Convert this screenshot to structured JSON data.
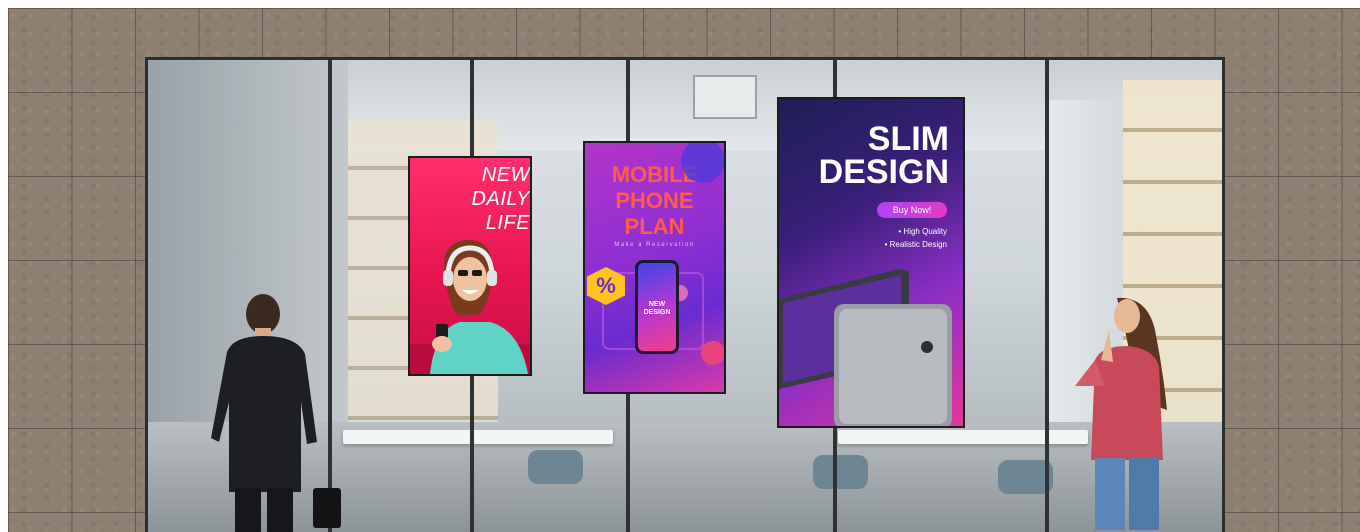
{
  "screens": {
    "left": {
      "lines": [
        "NEW",
        "DAILY",
        "LIFE"
      ]
    },
    "center": {
      "lines": [
        "MOBILE",
        "PHONE",
        "PLAN"
      ],
      "subtitle": "Make a Reservation",
      "badge": "%",
      "phone_text": [
        "NEW",
        "DESIGN"
      ]
    },
    "right": {
      "lines": [
        "SLIM",
        "DESIGN"
      ],
      "button": "Buy Now!",
      "bullets": [
        "• High Quality",
        "• Realistic Design"
      ]
    }
  },
  "colors": {
    "left_screen": "#e7154f",
    "center_screen_text": "#ff5a4a",
    "right_screen_button": "#d53ad0",
    "window_frame": "#2b2e31"
  }
}
